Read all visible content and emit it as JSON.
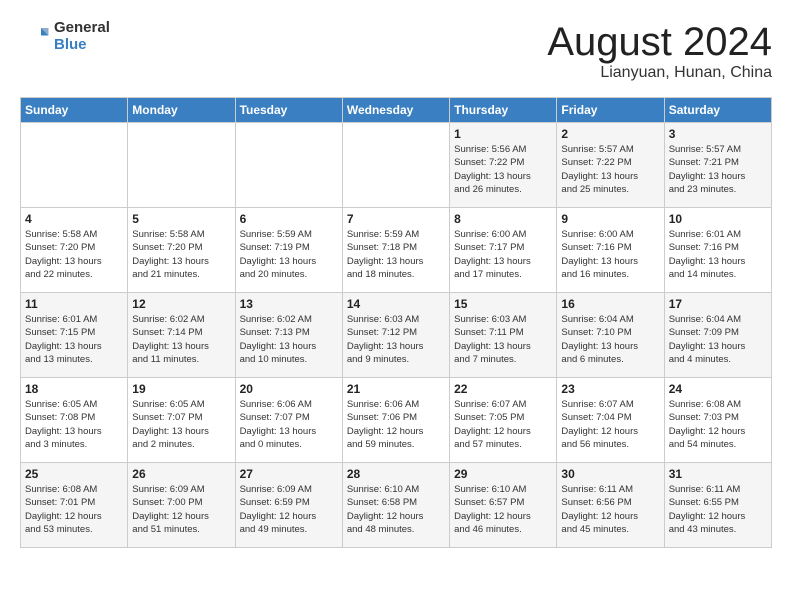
{
  "logo": {
    "general": "General",
    "blue": "Blue"
  },
  "title": "August 2024",
  "subtitle": "Lianyuan, Hunan, China",
  "headers": [
    "Sunday",
    "Monday",
    "Tuesday",
    "Wednesday",
    "Thursday",
    "Friday",
    "Saturday"
  ],
  "weeks": [
    [
      {
        "day": "",
        "info": ""
      },
      {
        "day": "",
        "info": ""
      },
      {
        "day": "",
        "info": ""
      },
      {
        "day": "",
        "info": ""
      },
      {
        "day": "1",
        "info": "Sunrise: 5:56 AM\nSunset: 7:22 PM\nDaylight: 13 hours\nand 26 minutes."
      },
      {
        "day": "2",
        "info": "Sunrise: 5:57 AM\nSunset: 7:22 PM\nDaylight: 13 hours\nand 25 minutes."
      },
      {
        "day": "3",
        "info": "Sunrise: 5:57 AM\nSunset: 7:21 PM\nDaylight: 13 hours\nand 23 minutes."
      }
    ],
    [
      {
        "day": "4",
        "info": "Sunrise: 5:58 AM\nSunset: 7:20 PM\nDaylight: 13 hours\nand 22 minutes."
      },
      {
        "day": "5",
        "info": "Sunrise: 5:58 AM\nSunset: 7:20 PM\nDaylight: 13 hours\nand 21 minutes."
      },
      {
        "day": "6",
        "info": "Sunrise: 5:59 AM\nSunset: 7:19 PM\nDaylight: 13 hours\nand 20 minutes."
      },
      {
        "day": "7",
        "info": "Sunrise: 5:59 AM\nSunset: 7:18 PM\nDaylight: 13 hours\nand 18 minutes."
      },
      {
        "day": "8",
        "info": "Sunrise: 6:00 AM\nSunset: 7:17 PM\nDaylight: 13 hours\nand 17 minutes."
      },
      {
        "day": "9",
        "info": "Sunrise: 6:00 AM\nSunset: 7:16 PM\nDaylight: 13 hours\nand 16 minutes."
      },
      {
        "day": "10",
        "info": "Sunrise: 6:01 AM\nSunset: 7:16 PM\nDaylight: 13 hours\nand 14 minutes."
      }
    ],
    [
      {
        "day": "11",
        "info": "Sunrise: 6:01 AM\nSunset: 7:15 PM\nDaylight: 13 hours\nand 13 minutes."
      },
      {
        "day": "12",
        "info": "Sunrise: 6:02 AM\nSunset: 7:14 PM\nDaylight: 13 hours\nand 11 minutes."
      },
      {
        "day": "13",
        "info": "Sunrise: 6:02 AM\nSunset: 7:13 PM\nDaylight: 13 hours\nand 10 minutes."
      },
      {
        "day": "14",
        "info": "Sunrise: 6:03 AM\nSunset: 7:12 PM\nDaylight: 13 hours\nand 9 minutes."
      },
      {
        "day": "15",
        "info": "Sunrise: 6:03 AM\nSunset: 7:11 PM\nDaylight: 13 hours\nand 7 minutes."
      },
      {
        "day": "16",
        "info": "Sunrise: 6:04 AM\nSunset: 7:10 PM\nDaylight: 13 hours\nand 6 minutes."
      },
      {
        "day": "17",
        "info": "Sunrise: 6:04 AM\nSunset: 7:09 PM\nDaylight: 13 hours\nand 4 minutes."
      }
    ],
    [
      {
        "day": "18",
        "info": "Sunrise: 6:05 AM\nSunset: 7:08 PM\nDaylight: 13 hours\nand 3 minutes."
      },
      {
        "day": "19",
        "info": "Sunrise: 6:05 AM\nSunset: 7:07 PM\nDaylight: 13 hours\nand 2 minutes."
      },
      {
        "day": "20",
        "info": "Sunrise: 6:06 AM\nSunset: 7:07 PM\nDaylight: 13 hours\nand 0 minutes."
      },
      {
        "day": "21",
        "info": "Sunrise: 6:06 AM\nSunset: 7:06 PM\nDaylight: 12 hours\nand 59 minutes."
      },
      {
        "day": "22",
        "info": "Sunrise: 6:07 AM\nSunset: 7:05 PM\nDaylight: 12 hours\nand 57 minutes."
      },
      {
        "day": "23",
        "info": "Sunrise: 6:07 AM\nSunset: 7:04 PM\nDaylight: 12 hours\nand 56 minutes."
      },
      {
        "day": "24",
        "info": "Sunrise: 6:08 AM\nSunset: 7:03 PM\nDaylight: 12 hours\nand 54 minutes."
      }
    ],
    [
      {
        "day": "25",
        "info": "Sunrise: 6:08 AM\nSunset: 7:01 PM\nDaylight: 12 hours\nand 53 minutes."
      },
      {
        "day": "26",
        "info": "Sunrise: 6:09 AM\nSunset: 7:00 PM\nDaylight: 12 hours\nand 51 minutes."
      },
      {
        "day": "27",
        "info": "Sunrise: 6:09 AM\nSunset: 6:59 PM\nDaylight: 12 hours\nand 49 minutes."
      },
      {
        "day": "28",
        "info": "Sunrise: 6:10 AM\nSunset: 6:58 PM\nDaylight: 12 hours\nand 48 minutes."
      },
      {
        "day": "29",
        "info": "Sunrise: 6:10 AM\nSunset: 6:57 PM\nDaylight: 12 hours\nand 46 minutes."
      },
      {
        "day": "30",
        "info": "Sunrise: 6:11 AM\nSunset: 6:56 PM\nDaylight: 12 hours\nand 45 minutes."
      },
      {
        "day": "31",
        "info": "Sunrise: 6:11 AM\nSunset: 6:55 PM\nDaylight: 12 hours\nand 43 minutes."
      }
    ]
  ]
}
